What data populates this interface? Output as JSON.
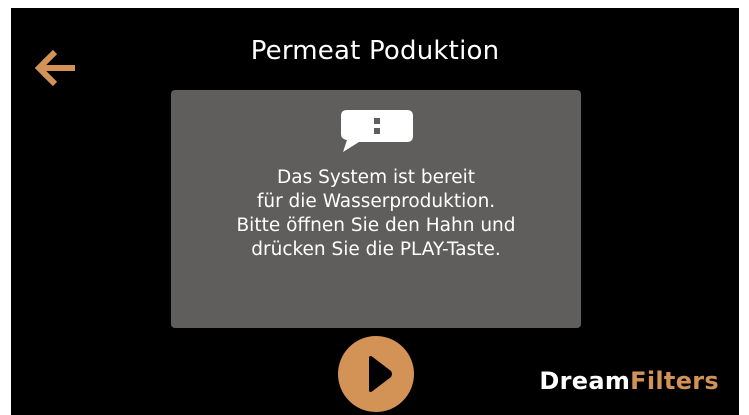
{
  "header": {
    "title": "Permeat Poduktion",
    "back_icon": "arrow-left-icon"
  },
  "dialog": {
    "icon": "message-alert-icon",
    "lines": [
      "Das System ist bereit",
      "für die Wasserproduktion.",
      "Bitte öffnen Sie den Hahn und",
      "drücken Sie die PLAY-Taste."
    ]
  },
  "controls": {
    "play_icon": "play-icon"
  },
  "brand": {
    "part1": "Dream",
    "part2": "Filters"
  },
  "colors": {
    "background": "#000000",
    "accent": "#d39356",
    "dialog_background": "#5f5e5d",
    "text": "#ffffff"
  }
}
